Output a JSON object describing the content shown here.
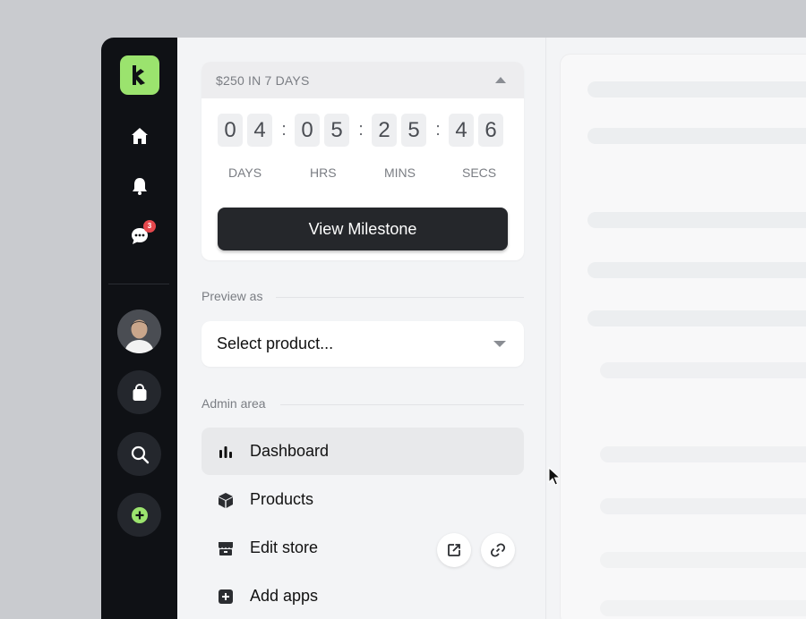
{
  "milestone": {
    "title": "$250 IN 7 DAYS",
    "digits": {
      "days": [
        "0",
        "4"
      ],
      "hrs": [
        "0",
        "5"
      ],
      "mins": [
        "2",
        "5"
      ],
      "secs": [
        "4",
        "6"
      ]
    },
    "colon": ":",
    "labels": {
      "days": "DAYS",
      "hrs": "HRS",
      "mins": "MINS",
      "secs": "SECS"
    },
    "button_label": "View Milestone"
  },
  "preview": {
    "section_label": "Preview as",
    "select_value": "Select product..."
  },
  "admin": {
    "section_label": "Admin area",
    "items": [
      {
        "label": "Dashboard",
        "icon": "bar-chart-icon",
        "active": true
      },
      {
        "label": "Products",
        "icon": "box-icon"
      },
      {
        "label": "Edit store",
        "icon": "store-icon"
      },
      {
        "label": "Add apps",
        "icon": "plus-square-icon"
      }
    ]
  },
  "rail": {
    "notification_badge": "3",
    "icons": [
      "logo-icon",
      "home-icon",
      "bell-icon",
      "chat-icon",
      "avatar",
      "shopping-bag-icon",
      "search-icon",
      "add-circle-icon"
    ]
  },
  "colors": {
    "accent_green": "#9be36e",
    "rail_bg": "#0f1115",
    "badge_red": "#e5484d",
    "button_dark": "#25272b"
  }
}
